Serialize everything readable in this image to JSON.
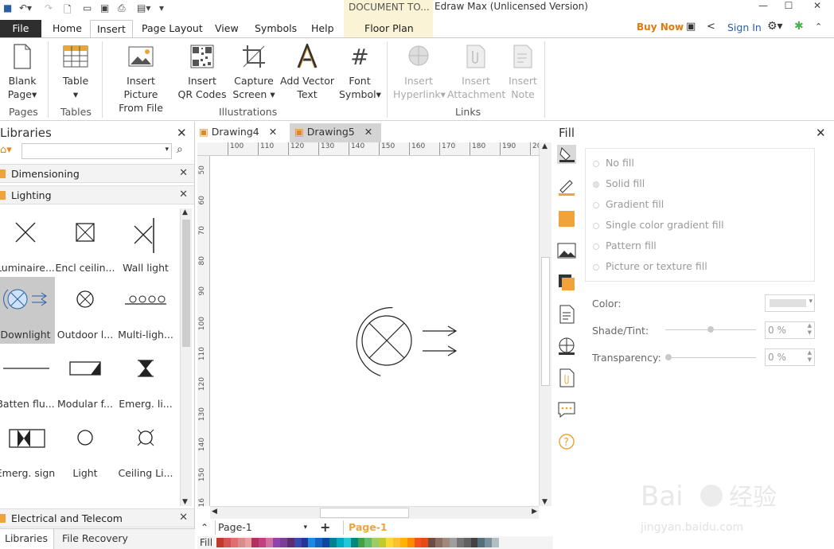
{
  "titlebar": {
    "document_tab": "DOCUMENT TO...",
    "app_title": "Edraw Max (Unlicensed Version)"
  },
  "tabs": {
    "file": "File",
    "home": "Home",
    "insert": "Insert",
    "page_layout": "Page Layout",
    "view": "View",
    "symbols": "Symbols",
    "help": "Help",
    "floor_plan": "Floor Plan",
    "buy_now": "Buy Now",
    "sign_in": "Sign In"
  },
  "ribbon": {
    "blank_page": [
      "Blank",
      "Page"
    ],
    "table": "Table",
    "insert_picture": [
      "Insert Picture",
      "From File"
    ],
    "insert_qr": [
      "Insert",
      "QR Codes"
    ],
    "capture_screen": [
      "Capture",
      "Screen"
    ],
    "add_vector_text": [
      "Add Vector",
      "Text"
    ],
    "font_symbol": [
      "Font",
      "Symbol"
    ],
    "insert_hyperlink": [
      "Insert",
      "Hyperlink"
    ],
    "insert_attachment": [
      "Insert",
      "Attachment"
    ],
    "insert_note": [
      "Insert",
      "Note"
    ],
    "groups": {
      "pages": "Pages",
      "tables": "Tables",
      "illustrations": "Illustrations",
      "links": "Links"
    }
  },
  "libraries": {
    "title": "Libraries",
    "categories": [
      "Dimensioning",
      "Lighting",
      "Electrical and Telecom"
    ],
    "shapes": [
      {
        "label": "Luminaire..."
      },
      {
        "label": "Encl ceilin..."
      },
      {
        "label": "Wall light"
      },
      {
        "label": "Downlight"
      },
      {
        "label": "Outdoor l..."
      },
      {
        "label": "Multi-ligh..."
      },
      {
        "label": "Batten flu..."
      },
      {
        "label": "Modular f..."
      },
      {
        "label": "Emerg. li..."
      },
      {
        "label": "Emerg. sign"
      },
      {
        "label": "Light"
      },
      {
        "label": "Ceiling Li..."
      }
    ],
    "bottom_tabs": [
      "Libraries",
      "File Recovery"
    ]
  },
  "doc_tabs": [
    "Drawing4",
    "Drawing5"
  ],
  "ruler": {
    "top": [
      "100",
      "110",
      "120",
      "130",
      "140",
      "150",
      "160",
      "170",
      "180",
      "190",
      "20"
    ],
    "left": [
      "50",
      "60",
      "70",
      "80",
      "90",
      "100",
      "110",
      "120",
      "130",
      "140",
      "150",
      "16"
    ]
  },
  "pagebar": {
    "page_select": "Page-1",
    "active_page": "Page-1",
    "fill_label": "Fill"
  },
  "fill_panel": {
    "title": "Fill",
    "options": [
      "No fill",
      "Solid fill",
      "Gradient fill",
      "Single color gradient fill",
      "Pattern fill",
      "Picture or texture fill"
    ],
    "color_label": "Color:",
    "shade_label": "Shade/Tint:",
    "shade_value": "0 %",
    "transparency_label": "Transparency:",
    "transparency_value": "0 %"
  },
  "palette": [
    "#c0392b",
    "#d35454",
    "#e07070",
    "#d98c8c",
    "#e8a0a0",
    "#b03060",
    "#c04080",
    "#d070a0",
    "#8e44ad",
    "#7d3c98",
    "#5b2c6f",
    "#3949ab",
    "#283593",
    "#1e88e5",
    "#1565c0",
    "#0d47a1",
    "#00838f",
    "#00acc1",
    "#26c6da",
    "#00897b",
    "#43a047",
    "#66bb6a",
    "#9ccc65",
    "#c0ca33",
    "#fdd835",
    "#fbc02d",
    "#ffb300",
    "#fb8c00",
    "#f4511e",
    "#e64a19",
    "#6d4c41",
    "#8d6e63",
    "#a1887f",
    "#9e9e9e",
    "#757575",
    "#616161",
    "#424242",
    "#546e7a",
    "#78909c",
    "#b0bec5"
  ]
}
